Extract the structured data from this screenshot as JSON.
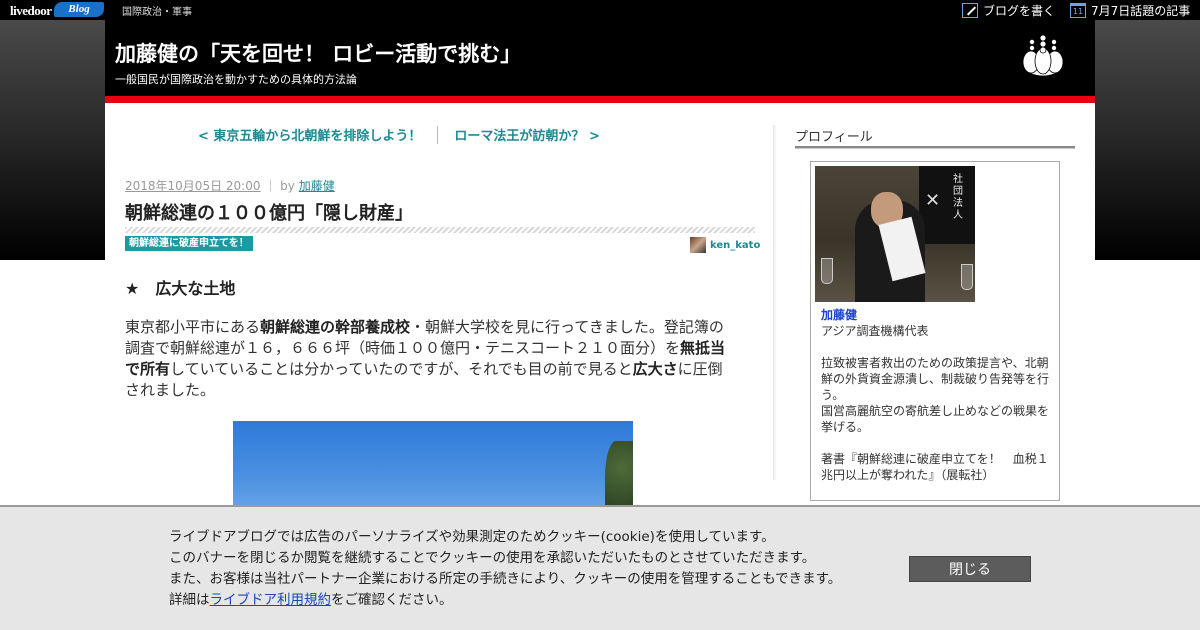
{
  "topbar": {
    "logo_text": "livedoor",
    "logo_badge": "Blog",
    "category": "国際政治・軍事",
    "write_label": "ブログを書く",
    "topic_icon_number": "11",
    "topic_label": "7月7日話題の記事"
  },
  "header": {
    "title": "加藤健の「天を回せ！ ロビー活動で挑む」",
    "subtitle": "一般国民が国際政治を動かすための具体的方法論"
  },
  "post_nav": {
    "prev": "< 東京五輪から北朝鮮を排除しよう！",
    "next": "ローマ法王が訪朝か？ >"
  },
  "article": {
    "date": "2018年10月05日 20:00",
    "sep": "｜ by",
    "author": "加藤健",
    "title": "朝鮮総連の１００億円「隠し財産」",
    "category": "朝鮮総連に破産申立てを！",
    "author_id": "ken_kato",
    "section_heading": "★　広大な土地",
    "p1": "東京都小平市にある",
    "b1": "朝鮮総連の幹部養成校",
    "p2": "・朝鮮大学校を見に行ってきました。登記簿の調査で朝鮮総連が１６，６６６坪（時価１００億円・テニスコート２１０面分）を",
    "b2": "無抵当で所有",
    "p3": "していていることは分かっていたのですが、それでも目の前で見ると",
    "b3": "広大さ",
    "p4": "に圧倒されました。"
  },
  "sidebar": {
    "heading": "プロフィール",
    "photo_sign": "社団法人",
    "name": "加藤健",
    "text": "アジア調査機構代表\n\n拉致被害者救出のための政策提言や、北朝鮮の外貨資金源潰し、制裁破り告発等を行う。\n国営高麗航空の寄航差し止めなどの戦果を挙げる。\n\n著書『朝鮮総連に破産申立てを！　血税１兆円以上が奪われた』（展転社）"
  },
  "cookie": {
    "line1": "ライブドアブログでは広告のパーソナライズや効果測定のためクッキー(cookie)を使用しています。",
    "line2": "このバナーを閉じるか閲覧を継続することでクッキーの使用を承認いただいたものとさせていただきます。",
    "line3": "また、お客様は当社パートナー企業における所定の手続きにより、クッキーの使用を管理することもできます。",
    "line4_pre": "詳細は",
    "line4_link": "ライブドア利用規約",
    "line4_post": "をご確認ください。",
    "close_label": "閉じる"
  },
  "colors": {
    "header_bg": "#000000",
    "accent_red": "#e60012",
    "link_teal": "#1b8a94",
    "tag_bg": "#1b9aa4",
    "banner_bg": "#e6e6e6",
    "close_button_bg": "#5c5c5c"
  },
  "icons": {
    "write": "pencil-icon",
    "topic": "calendar-icon",
    "crest": "paulownia-crest-icon"
  }
}
